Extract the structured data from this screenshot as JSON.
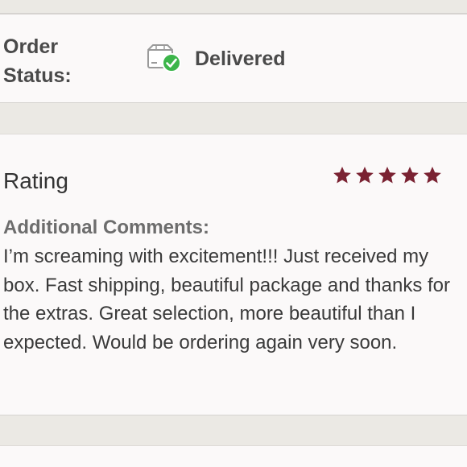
{
  "order_status": {
    "label": "Order Status:",
    "icon": "package-delivered-icon",
    "value": "Delivered",
    "check_color": "#3cb54a"
  },
  "rating": {
    "title": "Rating",
    "stars": 5,
    "max_stars": 5,
    "star_color": "#7a2232"
  },
  "comments": {
    "label": "Additional Comments:",
    "text": "I’m screaming with excitement!!! Just received my box. Fast shipping, beautiful package and thanks for the extras. Great selection, more beautiful than I expected. Would be ordering again very soon."
  }
}
